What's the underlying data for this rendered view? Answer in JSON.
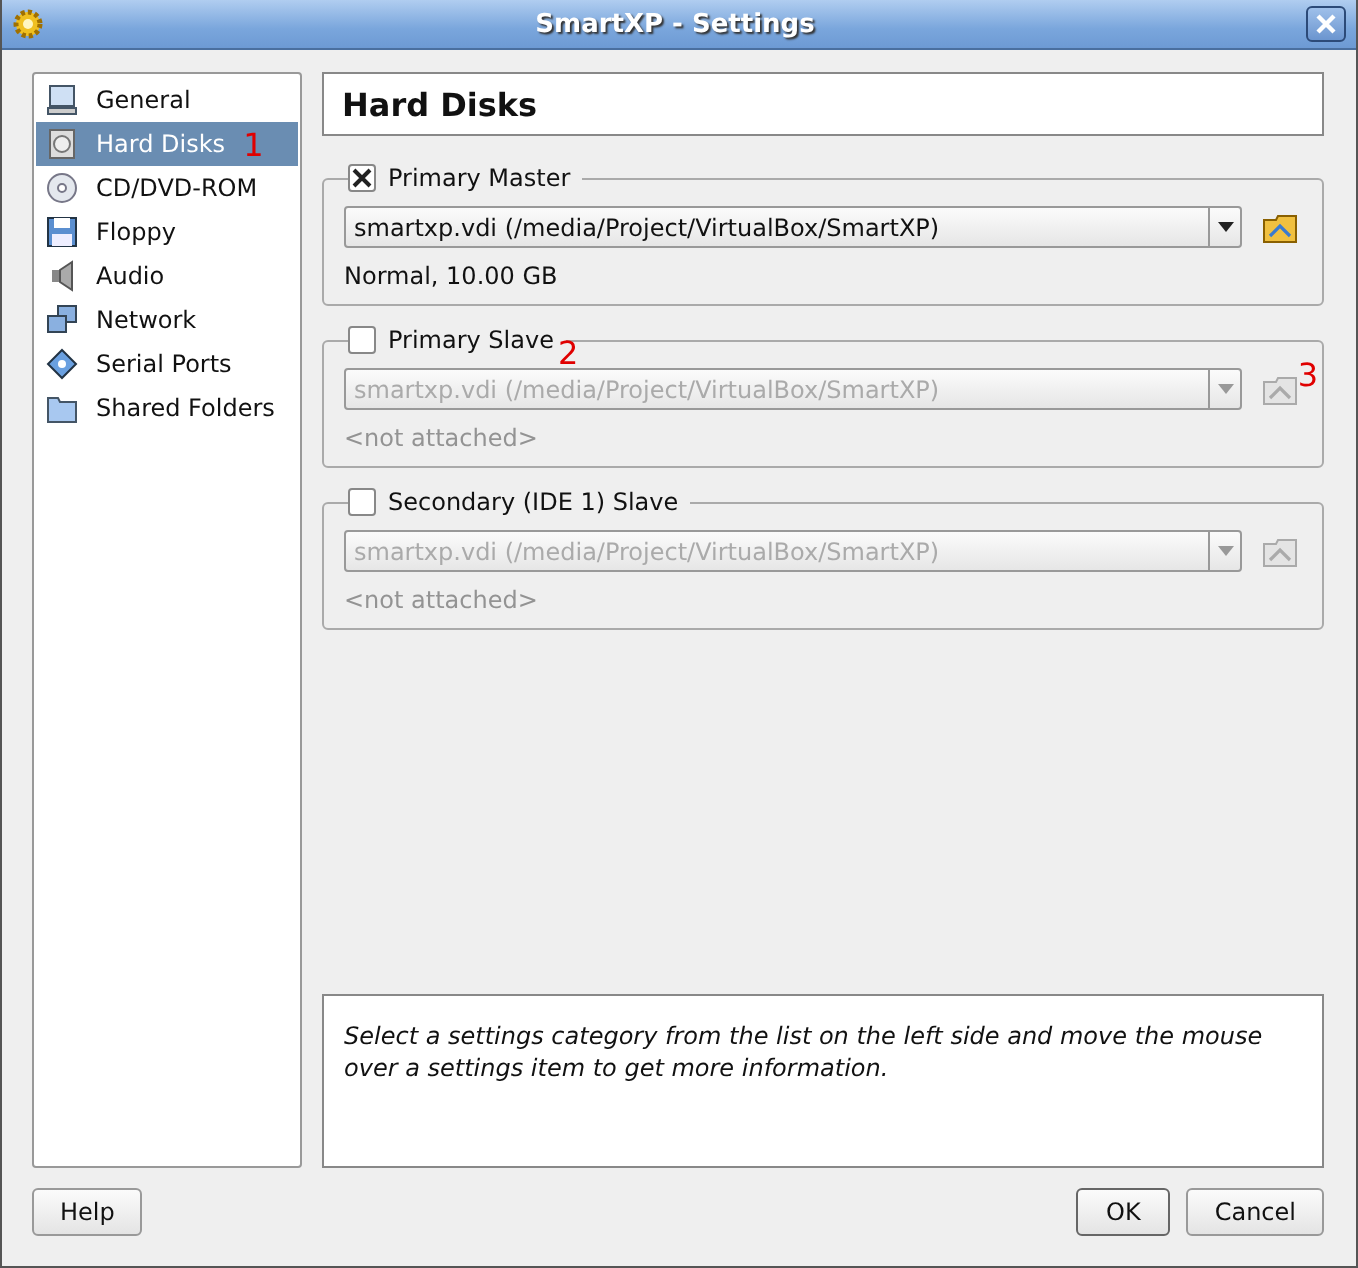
{
  "window": {
    "title": "SmartXP - Settings"
  },
  "sidebar": {
    "items": [
      {
        "label": "General",
        "kind": "monitor",
        "selected": false
      },
      {
        "label": "Hard Disks",
        "kind": "disk",
        "selected": true,
        "annotation": "1"
      },
      {
        "label": "CD/DVD-ROM",
        "kind": "cd",
        "selected": false
      },
      {
        "label": "Floppy",
        "kind": "floppy",
        "selected": false
      },
      {
        "label": "Audio",
        "kind": "speaker",
        "selected": false
      },
      {
        "label": "Network",
        "kind": "network",
        "selected": false
      },
      {
        "label": "Serial Ports",
        "kind": "serial",
        "selected": false
      },
      {
        "label": "Shared Folders",
        "kind": "folder",
        "selected": false
      }
    ]
  },
  "page": {
    "title": "Hard Disks",
    "slots": [
      {
        "label": "Primary Master",
        "checked": true,
        "combo": "smartxp.vdi (/media/Project/VirtualBox/SmartXP)",
        "info": "Normal, 10.00 GB"
      },
      {
        "label": "Primary Slave",
        "checked": false,
        "combo": "smartxp.vdi (/media/Project/VirtualBox/SmartXP)",
        "info": "<not attached>",
        "annotation": "2",
        "button_annotation": "3"
      },
      {
        "label": "Secondary (IDE 1) Slave",
        "checked": false,
        "combo": "smartxp.vdi (/media/Project/VirtualBox/SmartXP)",
        "info": "<not attached>"
      }
    ]
  },
  "info_text": "Select a settings category from the list on the left side and move the mouse over a settings item to get more information.",
  "buttons": {
    "help": "Help",
    "ok": "OK",
    "cancel": "Cancel"
  }
}
